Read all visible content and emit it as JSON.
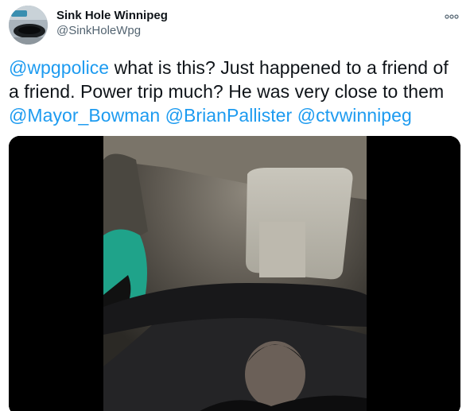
{
  "user": {
    "display_name": "Sink Hole Winnipeg",
    "handle": "@SinkHoleWpg",
    "avatar_icon": "user-avatar-photo"
  },
  "menu": {
    "icon": "more-options-icon"
  },
  "tweet": {
    "segments": [
      {
        "type": "mention",
        "text": "@wpgpolice"
      },
      {
        "type": "text",
        "text": " what is this? Just happened to a friend of a friend. Power trip much? He was very close to them "
      },
      {
        "type": "mention",
        "text": "@Mayor_Bowman"
      },
      {
        "type": "text",
        "text": " "
      },
      {
        "type": "mention",
        "text": "@BrianPallister"
      },
      {
        "type": "text",
        "text": " "
      },
      {
        "type": "mention",
        "text": "@ctvwinnipeg"
      }
    ]
  },
  "media": {
    "type": "video-still"
  },
  "colors": {
    "accent": "#1d9bf0",
    "text": "#0f1419",
    "secondary": "#536471"
  }
}
